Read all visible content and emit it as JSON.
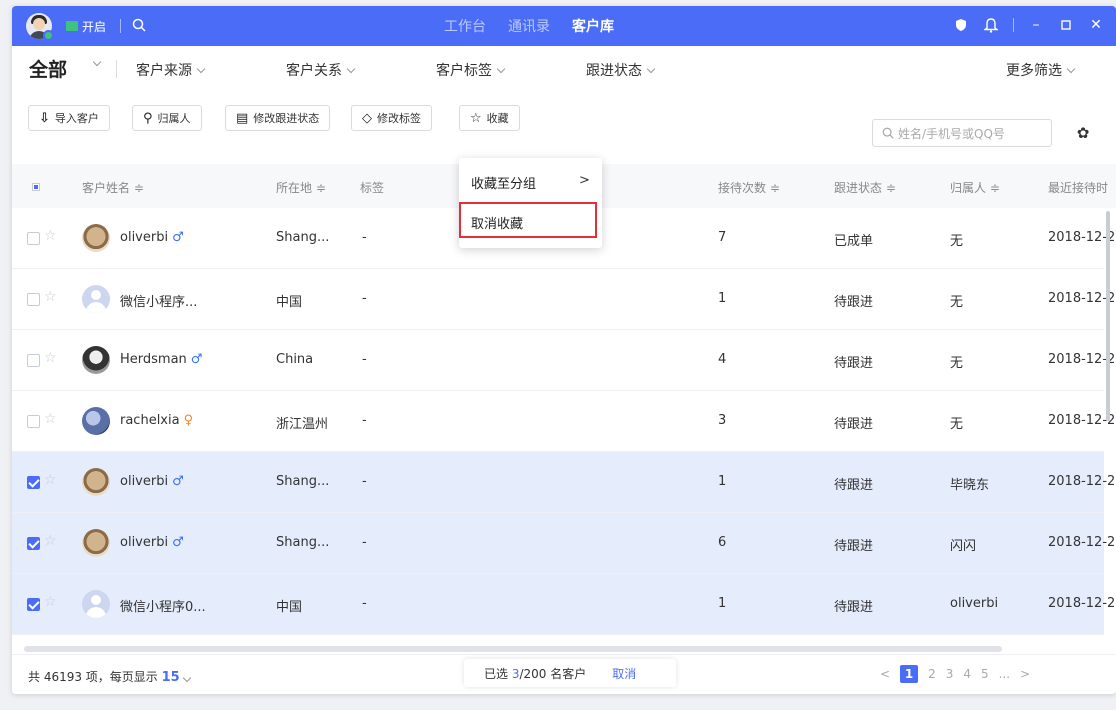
{
  "titlebar": {
    "open_label": "开启",
    "nav": [
      "工作台",
      "通讯录",
      "客户库"
    ],
    "active_nav_index": 2
  },
  "filters": {
    "all_label": "全部",
    "items": [
      "客户来源",
      "客户关系",
      "客户标签",
      "跟进状态"
    ],
    "more_label": "更多筛选"
  },
  "toolbar": {
    "import_label": "导入客户",
    "owner_label": "归属人",
    "edit_status_label": "修改跟进状态",
    "edit_tag_label": "修改标签",
    "favorite_label": "收藏",
    "search_placeholder": "姓名/手机号或QQ号"
  },
  "dropdown": {
    "items": [
      "收藏至分组",
      "取消收藏"
    ],
    "arrow": ">"
  },
  "table": {
    "columns": [
      "客户姓名 ≑",
      "所在地 ≑",
      "标签",
      "接待次数 ≑",
      "跟进状态 ≑",
      "归属人 ≑",
      "最近接待时"
    ],
    "rows": [
      {
        "name": "oliverbi",
        "gender": "♂",
        "location": "Shang...",
        "tag": "-",
        "visits": "7",
        "status": "已成单",
        "owner": "无",
        "date": "2018-12-2",
        "selected": false
      },
      {
        "name": "微信小程序...",
        "gender": "",
        "location": "中国",
        "tag": "-",
        "visits": "1",
        "status": "待跟进",
        "owner": "无",
        "date": "2018-12-2",
        "selected": false
      },
      {
        "name": "Herdsman",
        "gender": "♂",
        "location": "China",
        "tag": "-",
        "visits": "4",
        "status": "待跟进",
        "owner": "无",
        "date": "2018-12-2",
        "selected": false
      },
      {
        "name": "rachelxia",
        "gender": "♀",
        "location": "浙江温州",
        "tag": "-",
        "visits": "3",
        "status": "待跟进",
        "owner": "无",
        "date": "2018-12-2",
        "selected": false
      },
      {
        "name": "oliverbi",
        "gender": "♂",
        "location": "Shang...",
        "tag": "-",
        "visits": "1",
        "status": "待跟进",
        "owner": "毕晓东",
        "date": "2018-12-2",
        "selected": true
      },
      {
        "name": "oliverbi",
        "gender": "♂",
        "location": "Shang...",
        "tag": "-",
        "visits": "6",
        "status": "待跟进",
        "owner": "闪闪",
        "date": "2018-12-2",
        "selected": true
      },
      {
        "name": "微信小程序0...",
        "gender": "",
        "location": "中国",
        "tag": "-",
        "visits": "1",
        "status": "待跟进",
        "owner": "oliverbi",
        "date": "2018-12-2",
        "selected": true
      }
    ]
  },
  "footer": {
    "total_prefix": "共 46193 项，每页显示 ",
    "page_size": "15",
    "selected_prefix": "已选 ",
    "selected_count": "3",
    "selected_suffix": "/200 名客户",
    "cancel_label": "取消",
    "pages": [
      "1",
      "2",
      "3",
      "4",
      "5",
      "..."
    ],
    "prev": "<",
    "next": ">"
  },
  "colors": {
    "primary": "#4a6cf7",
    "selected_row": "#e5edfd",
    "highlight_border": "#e0303a"
  }
}
